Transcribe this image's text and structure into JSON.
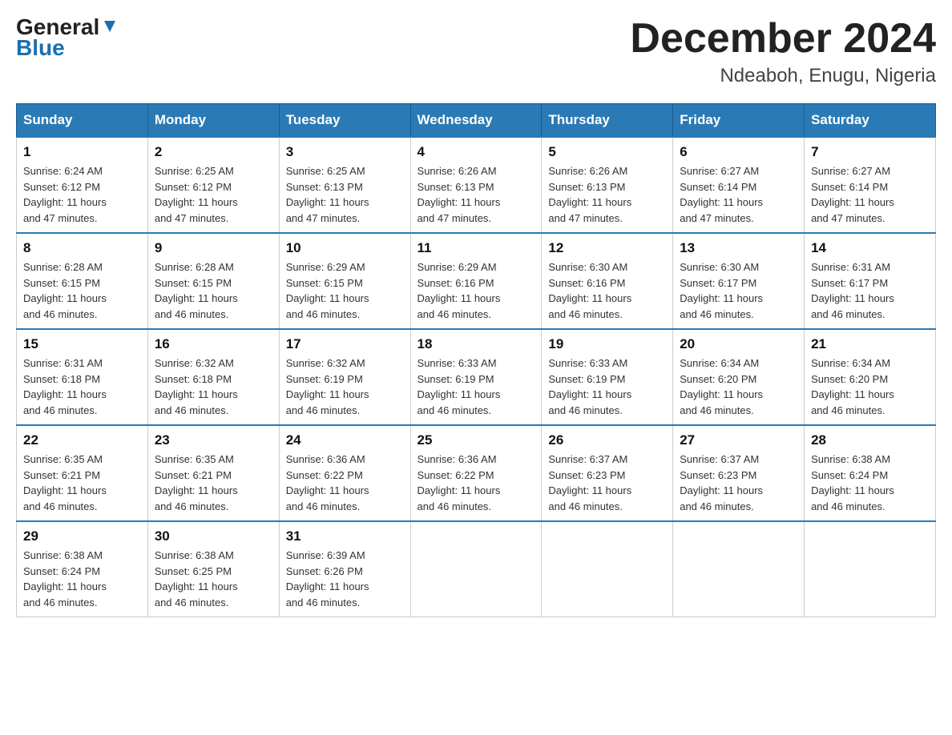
{
  "header": {
    "logo_general": "General",
    "logo_blue": "Blue",
    "month_title": "December 2024",
    "location": "Ndeaboh, Enugu, Nigeria"
  },
  "days_of_week": [
    "Sunday",
    "Monday",
    "Tuesday",
    "Wednesday",
    "Thursday",
    "Friday",
    "Saturday"
  ],
  "weeks": [
    [
      {
        "day": "1",
        "sunrise": "6:24 AM",
        "sunset": "6:12 PM",
        "daylight": "11 hours and 47 minutes."
      },
      {
        "day": "2",
        "sunrise": "6:25 AM",
        "sunset": "6:12 PM",
        "daylight": "11 hours and 47 minutes."
      },
      {
        "day": "3",
        "sunrise": "6:25 AM",
        "sunset": "6:13 PM",
        "daylight": "11 hours and 47 minutes."
      },
      {
        "day": "4",
        "sunrise": "6:26 AM",
        "sunset": "6:13 PM",
        "daylight": "11 hours and 47 minutes."
      },
      {
        "day": "5",
        "sunrise": "6:26 AM",
        "sunset": "6:13 PM",
        "daylight": "11 hours and 47 minutes."
      },
      {
        "day": "6",
        "sunrise": "6:27 AM",
        "sunset": "6:14 PM",
        "daylight": "11 hours and 47 minutes."
      },
      {
        "day": "7",
        "sunrise": "6:27 AM",
        "sunset": "6:14 PM",
        "daylight": "11 hours and 47 minutes."
      }
    ],
    [
      {
        "day": "8",
        "sunrise": "6:28 AM",
        "sunset": "6:15 PM",
        "daylight": "11 hours and 46 minutes."
      },
      {
        "day": "9",
        "sunrise": "6:28 AM",
        "sunset": "6:15 PM",
        "daylight": "11 hours and 46 minutes."
      },
      {
        "day": "10",
        "sunrise": "6:29 AM",
        "sunset": "6:15 PM",
        "daylight": "11 hours and 46 minutes."
      },
      {
        "day": "11",
        "sunrise": "6:29 AM",
        "sunset": "6:16 PM",
        "daylight": "11 hours and 46 minutes."
      },
      {
        "day": "12",
        "sunrise": "6:30 AM",
        "sunset": "6:16 PM",
        "daylight": "11 hours and 46 minutes."
      },
      {
        "day": "13",
        "sunrise": "6:30 AM",
        "sunset": "6:17 PM",
        "daylight": "11 hours and 46 minutes."
      },
      {
        "day": "14",
        "sunrise": "6:31 AM",
        "sunset": "6:17 PM",
        "daylight": "11 hours and 46 minutes."
      }
    ],
    [
      {
        "day": "15",
        "sunrise": "6:31 AM",
        "sunset": "6:18 PM",
        "daylight": "11 hours and 46 minutes."
      },
      {
        "day": "16",
        "sunrise": "6:32 AM",
        "sunset": "6:18 PM",
        "daylight": "11 hours and 46 minutes."
      },
      {
        "day": "17",
        "sunrise": "6:32 AM",
        "sunset": "6:19 PM",
        "daylight": "11 hours and 46 minutes."
      },
      {
        "day": "18",
        "sunrise": "6:33 AM",
        "sunset": "6:19 PM",
        "daylight": "11 hours and 46 minutes."
      },
      {
        "day": "19",
        "sunrise": "6:33 AM",
        "sunset": "6:19 PM",
        "daylight": "11 hours and 46 minutes."
      },
      {
        "day": "20",
        "sunrise": "6:34 AM",
        "sunset": "6:20 PM",
        "daylight": "11 hours and 46 minutes."
      },
      {
        "day": "21",
        "sunrise": "6:34 AM",
        "sunset": "6:20 PM",
        "daylight": "11 hours and 46 minutes."
      }
    ],
    [
      {
        "day": "22",
        "sunrise": "6:35 AM",
        "sunset": "6:21 PM",
        "daylight": "11 hours and 46 minutes."
      },
      {
        "day": "23",
        "sunrise": "6:35 AM",
        "sunset": "6:21 PM",
        "daylight": "11 hours and 46 minutes."
      },
      {
        "day": "24",
        "sunrise": "6:36 AM",
        "sunset": "6:22 PM",
        "daylight": "11 hours and 46 minutes."
      },
      {
        "day": "25",
        "sunrise": "6:36 AM",
        "sunset": "6:22 PM",
        "daylight": "11 hours and 46 minutes."
      },
      {
        "day": "26",
        "sunrise": "6:37 AM",
        "sunset": "6:23 PM",
        "daylight": "11 hours and 46 minutes."
      },
      {
        "day": "27",
        "sunrise": "6:37 AM",
        "sunset": "6:23 PM",
        "daylight": "11 hours and 46 minutes."
      },
      {
        "day": "28",
        "sunrise": "6:38 AM",
        "sunset": "6:24 PM",
        "daylight": "11 hours and 46 minutes."
      }
    ],
    [
      {
        "day": "29",
        "sunrise": "6:38 AM",
        "sunset": "6:24 PM",
        "daylight": "11 hours and 46 minutes."
      },
      {
        "day": "30",
        "sunrise": "6:38 AM",
        "sunset": "6:25 PM",
        "daylight": "11 hours and 46 minutes."
      },
      {
        "day": "31",
        "sunrise": "6:39 AM",
        "sunset": "6:26 PM",
        "daylight": "11 hours and 46 minutes."
      },
      null,
      null,
      null,
      null
    ]
  ],
  "labels": {
    "sunrise": "Sunrise:",
    "sunset": "Sunset:",
    "daylight": "Daylight:"
  }
}
